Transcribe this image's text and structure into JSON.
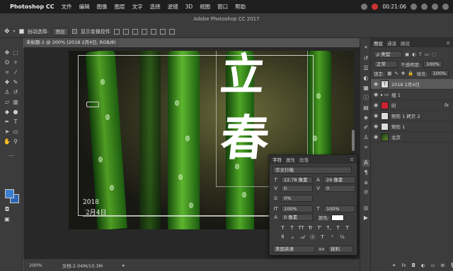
{
  "menubar": {
    "app_name": "Photoshop CC",
    "items": [
      "文件",
      "编辑",
      "图像",
      "图层",
      "文字",
      "选择",
      "滤镜",
      "3D",
      "视图",
      "窗口",
      "帮助"
    ],
    "clock": "00:21:06"
  },
  "titlebar": {
    "title": "Adobe Photoshop CC 2017"
  },
  "options_bar": {
    "auto_select_label": "自动选择:",
    "auto_select_value": "图层",
    "show_transform_label": "显示变换控件"
  },
  "document": {
    "tab_label": "未标题-1 @ 200% (2018 2月4日, RGB/8) *",
    "zoom": "200%",
    "file_info": "文档:2.04M/10.3M"
  },
  "artwork": {
    "big_char_1": "立",
    "big_char_2": "春",
    "caption_year": "2018",
    "caption_date": "2月4日"
  },
  "character_panel": {
    "tabs": [
      "字符",
      "属性",
      "段落"
    ],
    "font_family": "华文行楷",
    "font_size": "22.78 像素",
    "leading": "24 像素",
    "kerning": "0",
    "tracking": "0",
    "scale_pct": "0%",
    "vertical_scale": "100%",
    "horizontal_scale": "100%",
    "baseline_shift": "0 像素",
    "color_label": "颜色:",
    "style_buttons": [
      "T",
      "T",
      "TT",
      "Tr",
      "T'",
      "T,",
      "T",
      "T"
    ],
    "language": "美国英语",
    "antialias_icon": "aa",
    "antialias": "锐利"
  },
  "layers_panel": {
    "tabs": [
      "图层",
      "通道",
      "路径"
    ],
    "kind_filter": "ρ 类型",
    "blend_mode": "正常",
    "opacity_label": "不透明度:",
    "opacity": "100%",
    "lock_label": "锁定:",
    "fill_label": "填充:",
    "fill": "100%",
    "layers": [
      {
        "name": "2018 2月4日",
        "thumb": "T",
        "selected": true
      },
      {
        "name": "组 1",
        "thumb": "",
        "selected": false
      },
      {
        "name": "印",
        "thumb": "",
        "selected": false,
        "fx": "fx"
      },
      {
        "name": "矩形 1 拷贝 2",
        "thumb": "",
        "selected": false
      },
      {
        "name": "矩形 1",
        "thumb": "",
        "selected": false
      },
      {
        "name": "北京",
        "thumb": "",
        "selected": false
      }
    ]
  },
  "colors": {
    "foreground": "#3b7fd1",
    "background": "#2c66b3"
  }
}
